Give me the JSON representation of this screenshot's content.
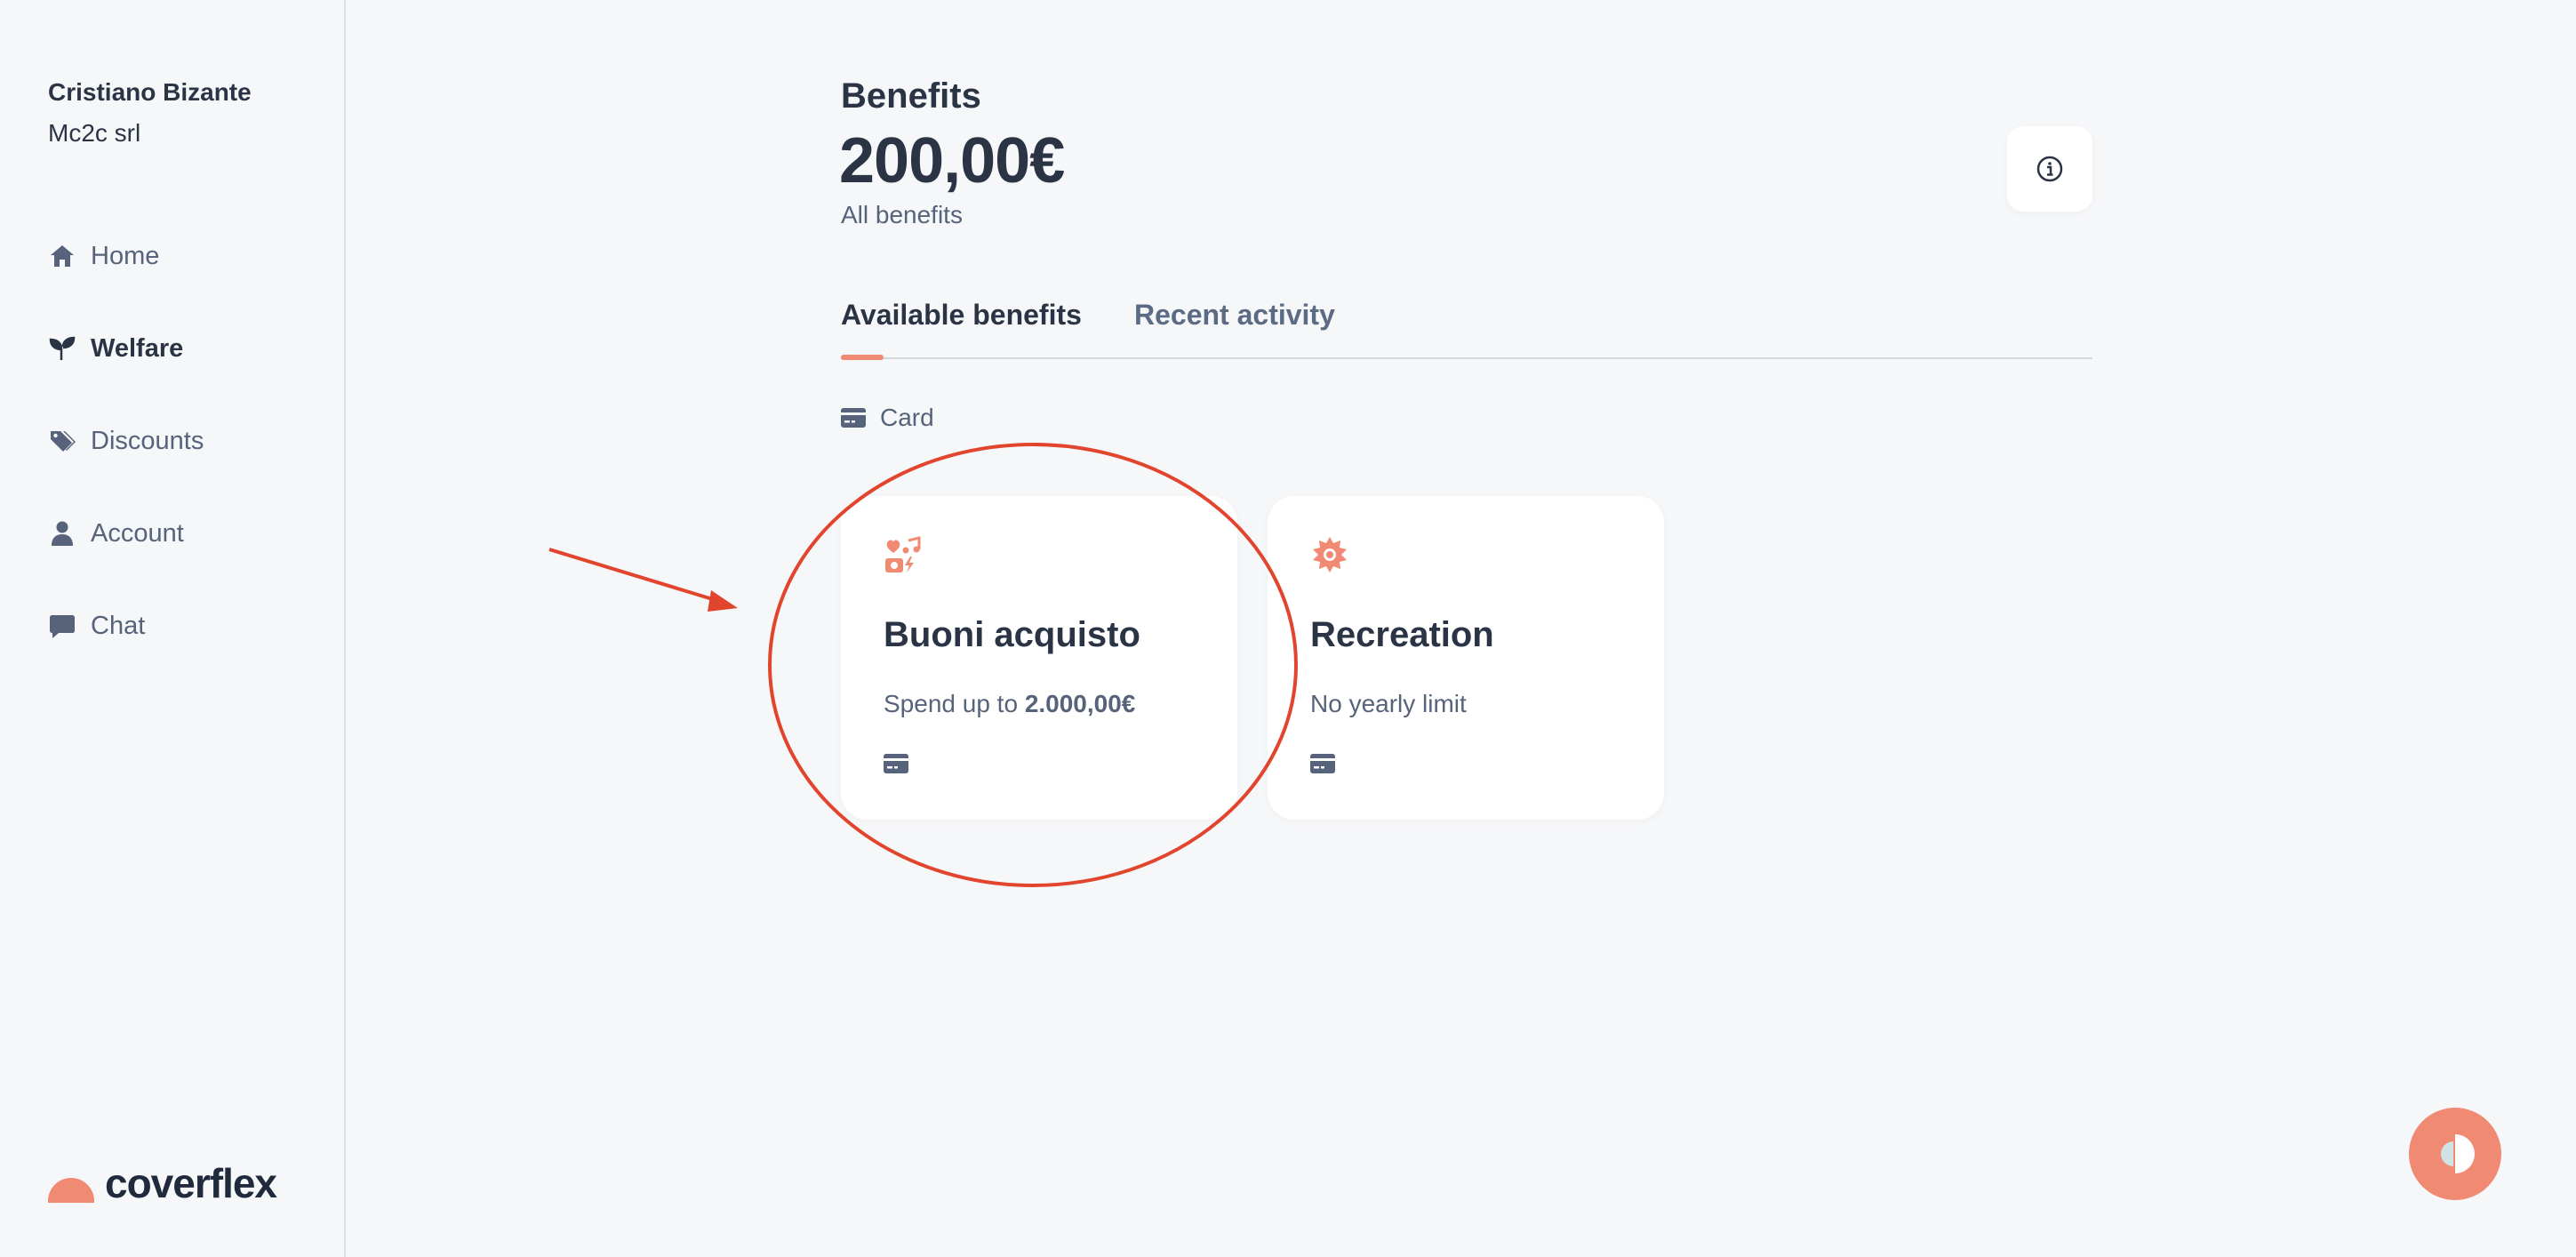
{
  "user": {
    "name": "Cristiano Bizante",
    "company": "Mc2c srl"
  },
  "nav": {
    "items": [
      {
        "label": "Home",
        "icon": "home-icon"
      },
      {
        "label": "Welfare",
        "icon": "sprout-icon",
        "active": true
      },
      {
        "label": "Discounts",
        "icon": "tags-icon"
      },
      {
        "label": "Account",
        "icon": "user-icon"
      },
      {
        "label": "Chat",
        "icon": "chat-bubble-icon"
      }
    ]
  },
  "brand": {
    "name": "coverflex",
    "accent": "#f08a73"
  },
  "header": {
    "title": "Benefits",
    "amount": "200,00€",
    "subtitle": "All benefits"
  },
  "tabs": [
    {
      "label": "Available benefits",
      "active": true
    },
    {
      "label": "Recent activity",
      "active": false
    }
  ],
  "section": {
    "label": "Card",
    "icon": "credit-card-icon"
  },
  "cards": [
    {
      "title": "Buoni acquisto",
      "sub_prefix": "Spend up to ",
      "sub_bold": "2.000,00€",
      "icon": "gift-music-icon"
    },
    {
      "title": "Recreation",
      "sub_prefix": "No yearly limit",
      "sub_bold": "",
      "icon": "sun-gear-icon"
    }
  ],
  "colors": {
    "text": "#2b3445",
    "muted": "#56637a",
    "background": "#f6f7f9",
    "annotation": "#e2452e"
  }
}
